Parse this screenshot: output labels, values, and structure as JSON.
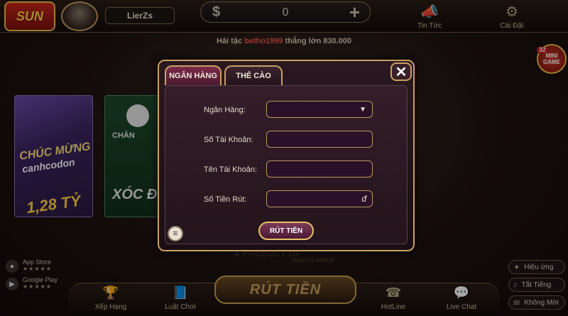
{
  "header": {
    "logo_text": "SUN",
    "username": "LierZs",
    "balance_symbol": "$",
    "balance": "0",
    "add_symbol": "+",
    "news_label": "Tin Tức",
    "settings_label": "Cài Đặt"
  },
  "ticker": {
    "prefix": "Hải tặc ",
    "player": "betho1999",
    "suffix": " thắng lớn 830.000"
  },
  "tiles": {
    "tile1_line1": "CHÚC MỪNG",
    "tile1_line2": "canhcodon",
    "tile1_line3": "1,28 TỶ",
    "tile2_label": "CHẴN",
    "tile2_title": "XÓC Đ"
  },
  "minigame": {
    "count": "32",
    "label": "MINI GAME"
  },
  "side_buttons": {
    "effects": "Hiệu ứng",
    "mute": "Tắt Tiếng",
    "invite": "Không Mời"
  },
  "stores": {
    "appstore": "App Store",
    "googleplay": "Google Play",
    "stars": "★★★★★"
  },
  "product": {
    "text": "A PRODUCT OF",
    "sub": "SUNCITY GROUP"
  },
  "bottom_nav": {
    "ranking": "Xếp Hạng",
    "rules": "Luật Chơi",
    "withdraw": "RÚT TIỀN",
    "hotline": "HotLine",
    "livechat": "Live Chat"
  },
  "modal": {
    "tab_bank": "NGÂN HÀNG",
    "tab_card": "THẺ CÀO",
    "close": "✕",
    "bank_label": "Ngân Hàng:",
    "account_number_label": "Số Tài Khoản:",
    "account_name_label": "Tên Tài Khoản:",
    "amount_label": "Số Tiền Rút:",
    "bank_value": "",
    "account_number_value": "",
    "account_name_value": "",
    "amount_value": "",
    "currency": "đ",
    "submit": "RÚT TIỀN"
  }
}
